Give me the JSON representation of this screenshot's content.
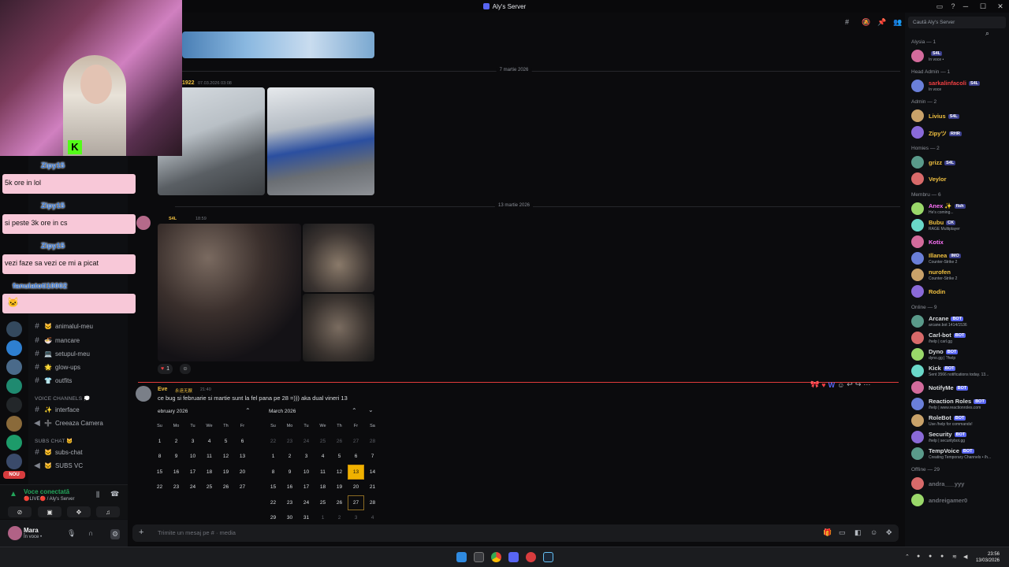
{
  "window": {
    "title": "Aly's Server"
  },
  "search": {
    "placeholder": "Caută Aly's Server"
  },
  "chat": {
    "dates": [
      "7 martie 2026",
      "13 martie 2026"
    ],
    "msg1": {
      "author": "1922",
      "time": "07.03.2026 03:08"
    },
    "msg2": {
      "badge": "S4L",
      "time": "18:59",
      "reaction_count": "1"
    },
    "msg3": {
      "author": "Eve",
      "badge": "永遠无厭",
      "time": "21:40",
      "text": "ce bug si februarie si martie sunt la fel pana pe 28 =))) aka dual vineri 13"
    },
    "input_placeholder": "Trimite un mesaj pe #",
    "input_suffix": "· media"
  },
  "calendar_feb": {
    "title": "ebruary 2026",
    "weekdays": [
      "Su",
      "Mo",
      "Tu",
      "We",
      "Th",
      "Fr"
    ],
    "rows": [
      [
        "1",
        "2",
        "3",
        "4",
        "5",
        "6"
      ],
      [
        "8",
        "9",
        "10",
        "11",
        "12",
        "13"
      ],
      [
        "15",
        "16",
        "17",
        "18",
        "19",
        "20"
      ],
      [
        "22",
        "23",
        "24",
        "25",
        "26",
        "27"
      ]
    ]
  },
  "calendar_mar": {
    "title": "March 2026",
    "weekdays": [
      "Su",
      "Mo",
      "Tu",
      "We",
      "Th",
      "Fr",
      "Sa"
    ],
    "rows": [
      [
        "22",
        "23",
        "24",
        "25",
        "26",
        "27",
        "28"
      ],
      [
        "1",
        "2",
        "3",
        "4",
        "5",
        "6",
        "7"
      ],
      [
        "8",
        "9",
        "10",
        "11",
        "12",
        "13",
        "14"
      ],
      [
        "15",
        "16",
        "17",
        "18",
        "19",
        "20",
        "21"
      ],
      [
        "22",
        "23",
        "24",
        "25",
        "26",
        "27",
        "28"
      ],
      [
        "29",
        "30",
        "31",
        "1",
        "2",
        "3",
        "4"
      ]
    ],
    "today": "13",
    "selected": "27"
  },
  "channels": [
    {
      "name": "animalul-meu",
      "emoji": "🐱"
    },
    {
      "name": "mancare",
      "emoji": "🍜"
    },
    {
      "name": "setupul-meu",
      "emoji": "💻"
    },
    {
      "name": "glow-ups",
      "emoji": "🌟"
    },
    {
      "name": "outfits",
      "emoji": "👕"
    }
  ],
  "voice_category": "VOICE CHANNELS 💭",
  "voice_channels": [
    {
      "name": "interface",
      "emoji": "✨"
    },
    {
      "name": "Creeaza Camera",
      "emoji": "➕"
    }
  ],
  "subs_category": "SUBS CHAT 🐱",
  "subs_channels": [
    {
      "name": "subs-chat",
      "emoji": "🐱"
    },
    {
      "name": "SUBS VC",
      "emoji": "🐱"
    }
  ],
  "voice_status": {
    "title": "Voce conectată",
    "sub": "🔴LIVE🔴 / Aly's Server"
  },
  "user": {
    "name": "Mara",
    "status": "În voce •"
  },
  "rail_badge": "NOU",
  "members": {
    "groups": [
      {
        "title": "Alysia — 1",
        "items": [
          {
            "name": "",
            "tag": "S4L",
            "status": "În voce • ",
            "color": "#f2f3f5"
          }
        ]
      },
      {
        "title": "Head Admin — 1",
        "items": [
          {
            "name": "sarkalinfacoli",
            "tag": "S4L",
            "status": "În voce",
            "color": "#f23f42"
          }
        ]
      },
      {
        "title": "Admin — 2",
        "items": [
          {
            "name": "Livius",
            "tag": "S4L",
            "status": "",
            "color": "#f0c040"
          },
          {
            "name": "Zipyツ",
            "tag": "RHR",
            "status": "",
            "color": "#f0c040"
          }
        ]
      },
      {
        "title": "Homies — 2",
        "items": [
          {
            "name": "grizz",
            "tag": "S4L",
            "status": "",
            "color": "#f0c040"
          },
          {
            "name": "Veylor",
            "tag": "",
            "status": "",
            "color": "#f0c040"
          }
        ]
      },
      {
        "title": "Membru — 6",
        "items": [
          {
            "name": "Anex ✨",
            "tag": "fish",
            "status": "He's coming...",
            "color": "#ff73fa"
          },
          {
            "name": "Bubu",
            "tag": "CK",
            "status": "RAGE Multiplayer",
            "color": "#f0c040"
          },
          {
            "name": "Kotix",
            "tag": "",
            "status": "",
            "color": "#ff73fa"
          },
          {
            "name": "Illanea",
            "tag": "IMO",
            "status": "Counter-Strike 2",
            "color": "#f0c040"
          },
          {
            "name": "nurofen",
            "tag": "",
            "status": "Counter-Strike 2",
            "color": "#f0c040"
          },
          {
            "name": "Rodin",
            "tag": "",
            "status": "",
            "color": "#f0c040"
          }
        ]
      },
      {
        "title": "Online — 9",
        "items": [
          {
            "name": "Arcane",
            "bot": "BOT",
            "status": "arcane.bot 1414/1536",
            "color": "#dbdee1"
          },
          {
            "name": "Carl-bot",
            "bot": "BOT",
            "status": "/help | carl.gg",
            "color": "#dbdee1"
          },
          {
            "name": "Dyno",
            "bot": "BOT",
            "status": "dyno.gg | ?help",
            "color": "#dbdee1"
          },
          {
            "name": "Kick",
            "bot": "BOT",
            "status": "Sent 3566 notifications today. 13...",
            "color": "#dbdee1"
          },
          {
            "name": "NotifyMe",
            "bot": "BOT",
            "status": "",
            "color": "#dbdee1"
          },
          {
            "name": "Reaction Roles",
            "bot": "BOT",
            "status": "/help | www.reactionroles.com",
            "color": "#dbdee1"
          },
          {
            "name": "RoleBot",
            "bot": "BOT",
            "status": "Use /help for commands!",
            "color": "#dbdee1"
          },
          {
            "name": "Security",
            "bot": "BOT",
            "status": "/help | securitybot.gg",
            "color": "#dbdee1"
          },
          {
            "name": "TempVoice",
            "bot": "BOT",
            "status": "Creating Temporary Channels • /h...",
            "color": "#dbdee1"
          }
        ]
      },
      {
        "title": "Offline — 29",
        "items": [
          {
            "name": "andra___yyy",
            "status": "",
            "color": "#6d7077"
          },
          {
            "name": "andreigamer0",
            "status": "",
            "color": "#6d7077"
          }
        ]
      }
    ]
  },
  "overlay": {
    "messages": [
      {
        "user": "Zipy15",
        "text": "5k ore in lol"
      },
      {
        "user": "Zipy15",
        "text": "si peste 3k ore in cs"
      },
      {
        "user": "Zipy15",
        "text": "vezi faze sa vezi ce mi a picat"
      },
      {
        "user": "fanulatoti10002",
        "text": ""
      }
    ]
  },
  "taskbar": {
    "time": "23:56",
    "date": "13/03/2026"
  }
}
